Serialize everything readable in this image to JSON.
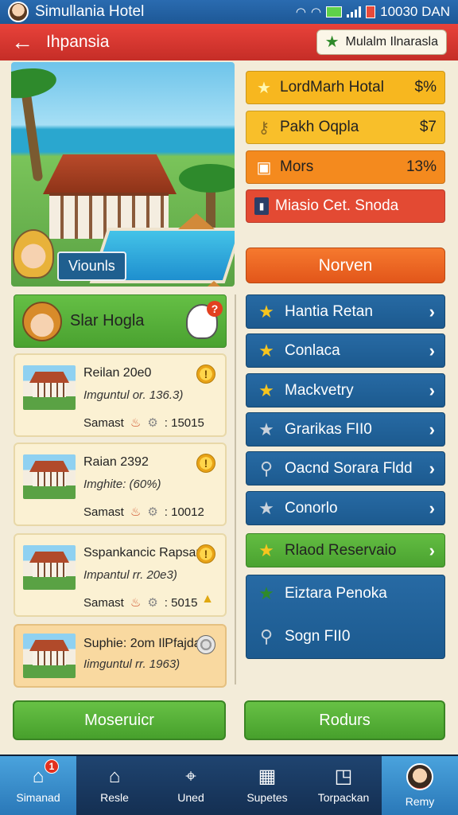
{
  "status_bar": {
    "app_title": "Simullania Hotel",
    "time": "10030 DAN"
  },
  "header": {
    "title": "Ihpansia",
    "action_label": "Mulalm Ilnarasla"
  },
  "hero": {
    "label": "Viounls"
  },
  "stats": [
    {
      "label": "LordMarh Hotal",
      "value": "$%",
      "icon": "star-icon"
    },
    {
      "label": "Pakh Oqpla",
      "value": "$7",
      "icon": "key-icon"
    },
    {
      "label": "Mors",
      "value": "13%",
      "icon": "calendar-icon"
    },
    {
      "label": "Miasio Cet. Snoda",
      "value": "",
      "icon": "phone-icon"
    }
  ],
  "primary_button": "Norven",
  "left_panel": {
    "title": "Slar Hogla",
    "hotels": [
      {
        "name": "Reilan 20e0",
        "sub": "Imguntul or. 136.3)",
        "foot_label": "Samast",
        "foot_value": ": 15015"
      },
      {
        "name": "Raian 2392",
        "sub": "Imghite: (60%)",
        "foot_label": "Samast",
        "foot_value": ": 10012"
      },
      {
        "name": "Sspankancic Rapsani",
        "sub": "Impantul rr. 20e3)",
        "foot_label": "Samast",
        "foot_value": ": 5015"
      },
      {
        "name": "Suphie: 2om IlPfajdak",
        "sub": "Iimguntul rr. 1963)"
      }
    ]
  },
  "menu": [
    {
      "label": "Hantia Retan",
      "icon": "star-icon"
    },
    {
      "label": "Conlaca",
      "icon": "star-icon"
    },
    {
      "label": "Mackvetry",
      "icon": "star-icon"
    },
    {
      "label": "Grarikas FII0",
      "icon": "star-icon"
    },
    {
      "label": "Oacnd Sorara Fldd",
      "icon": "search-icon"
    },
    {
      "label": "Conorlo",
      "icon": "star-icon"
    },
    {
      "label": "Rlaod Reservaio",
      "icon": "star-icon"
    }
  ],
  "menu_box": {
    "row1": "Eiztara Penoka",
    "row2": "Sogn FII0"
  },
  "bottom_buttons": {
    "left": "Moseruicr",
    "right": "Rodurs"
  },
  "nav": {
    "badge": "1",
    "items": [
      "Simanad",
      "Resle",
      "Uned",
      "Supetes",
      "Torpackan",
      "Remy"
    ]
  },
  "colors": {
    "header": "#d8362f",
    "status_bar": "#2162a4",
    "menu_blue": "#226296",
    "green": "#58b13a",
    "orange": "#ee6a24"
  }
}
